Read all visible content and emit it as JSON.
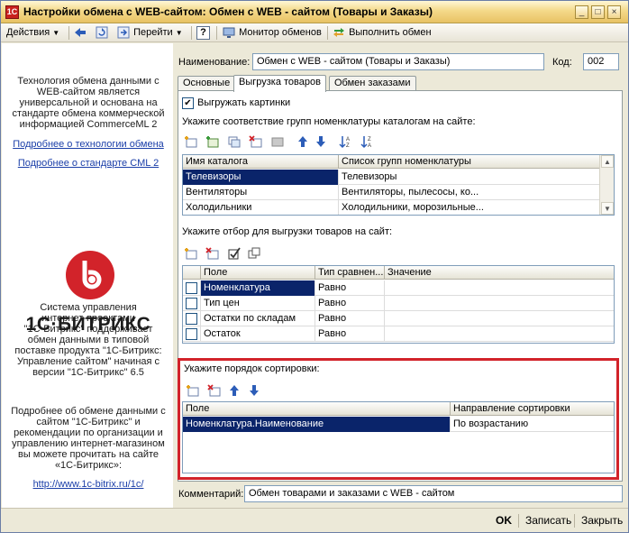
{
  "window": {
    "title": "Настройки обмена с WEB-сайтом: Обмен с WEB - сайтом (Товары и Заказы)"
  },
  "toolbar": {
    "actions_label": "Действия",
    "goto_label": "Перейти",
    "help_label": "?",
    "monitor_label": "Монитор обменов",
    "run_label": "Выполнить обмен"
  },
  "left_panel": {
    "intro_lines": [
      "Технология обмена данными с",
      "WEB-сайтом является",
      "универсальной и основана на",
      "стандарте обмена коммерческой",
      "информацией CommerceML 2"
    ],
    "link_tech": "Подробнее о технологии обмена",
    "link_cml": "Подробнее о стандарте CML 2",
    "logo_word": "1С·БИТРИКС",
    "about_lines": [
      "Система управления",
      "интернет-проектами",
      "\"1С-Битрикс\" поддерживает",
      "обмен данными в типовой",
      "поставке продукта \"1С-Битрикс:",
      "Управление сайтом\" начиная с",
      "версии \"1С-Битрикс\" 6.5"
    ],
    "more_lines": [
      "Подробнее об обмене данными с",
      "сайтом \"1С-Битрикс\" и",
      "рекомендации по организации и",
      "управлению интернет-магазином",
      "вы можете прочитать на сайте",
      "«1С-Битрикс»:"
    ],
    "site_link": "http://www.1c-bitrix.ru/1c/"
  },
  "form": {
    "name_label": "Наименование:",
    "name_value": "Обмен с WEB - сайтом (Товары и Заказы)",
    "code_label": "Код:",
    "code_value": "002",
    "comment_label": "Комментарий:",
    "comment_value": "Обмен товарами и заказами с WEB - сайтом"
  },
  "tabs": [
    {
      "label": "Основные"
    },
    {
      "label": "Выгрузка товаров"
    },
    {
      "label": "Обмен заказами"
    }
  ],
  "export_tab": {
    "upload_images_label": "Выгружать картинки",
    "upload_images_checked": true,
    "catalog_hint": "Укажите соответствие групп номенклатуры каталогам на сайте:",
    "catalog_columns": [
      "Имя каталога",
      "Список групп номенклатуры"
    ],
    "catalog_rows": [
      [
        "Телевизоры",
        "Телевизоры"
      ],
      [
        "Вентиляторы",
        "Вентиляторы, пылесосы, ко..."
      ],
      [
        "Холодильники",
        "Холодильники, морозильные..."
      ]
    ],
    "filter_hint": "Укажите отбор для выгрузки товаров на сайт:",
    "filter_columns": [
      "Поле",
      "Тип сравнен...",
      "Значение"
    ],
    "filter_rows": [
      [
        "Номенклатура",
        "Равно",
        ""
      ],
      [
        "Тип цен",
        "Равно",
        ""
      ],
      [
        "Остатки по складам",
        "Равно",
        ""
      ],
      [
        "Остаток",
        "Равно",
        ""
      ]
    ],
    "sort_hint": "Укажите порядок сортировки:",
    "sort_columns": [
      "Поле",
      "Направление сортировки"
    ],
    "sort_rows": [
      [
        "Номенклатура.Наименование",
        "По возрастанию"
      ]
    ]
  },
  "footer": {
    "ok_label": "OK",
    "save_label": "Записать",
    "close_label": "Закрыть"
  },
  "colors": {
    "selection": "#0a246a",
    "highlight_frame": "#d2232a",
    "bitrix_red": "#d2232a"
  },
  "icons": [
    "app-icon",
    "back-arrow-icon",
    "refresh-icon",
    "goto-icon",
    "help-icon",
    "monitor-icon",
    "run-exchange-icon",
    "add-row-icon",
    "copy-row-icon",
    "edit-row-icon",
    "delete-row-icon",
    "move-up-icon",
    "move-down-icon",
    "sort-asc-icon",
    "sort-desc-icon",
    "check-all-icon",
    "uncheck-all-icon",
    "bitrix-logo-icon"
  ]
}
